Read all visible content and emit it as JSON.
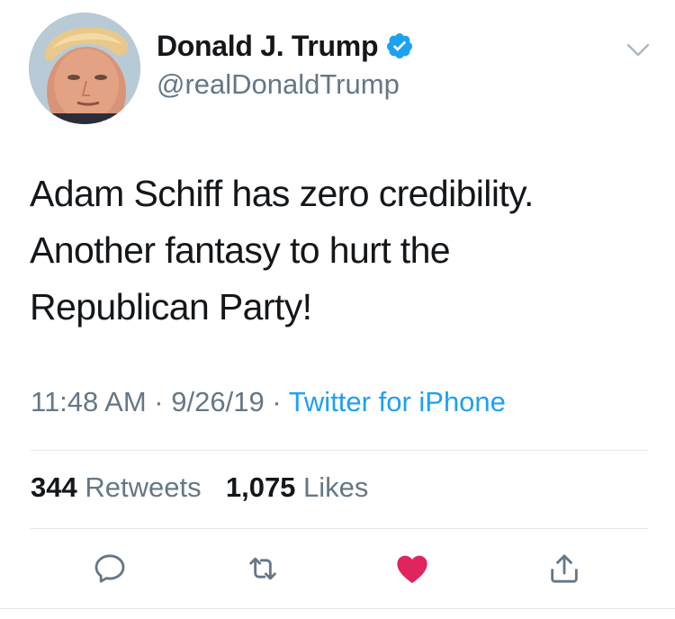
{
  "author": {
    "display_name": "Donald J. Trump",
    "handle": "@realDonaldTrump",
    "verified": true,
    "verified_icon": "verified-badge-icon"
  },
  "menu_icon": "chevron-down-icon",
  "tweet": {
    "lines": [
      "Adam Schiff has zero credibility.",
      "Another fantasy to hurt the",
      "Republican Party!"
    ]
  },
  "meta": {
    "time": "11:48 AM",
    "sep1": " · ",
    "date": "9/26/19",
    "sep2": " · ",
    "source": "Twitter for iPhone"
  },
  "stats": {
    "retweets_count": "344",
    "retweets_label": "Retweets",
    "likes_count": "1,075",
    "likes_label": "Likes"
  },
  "actions": {
    "reply_icon": "reply-icon",
    "retweet_icon": "retweet-icon",
    "like_icon": "heart-icon",
    "share_icon": "share-icon",
    "liked": true
  },
  "colors": {
    "text": "#14171a",
    "secondary": "#657786",
    "link": "#1da1f2",
    "like": "#e0245e",
    "divider": "#e1e8ed"
  }
}
